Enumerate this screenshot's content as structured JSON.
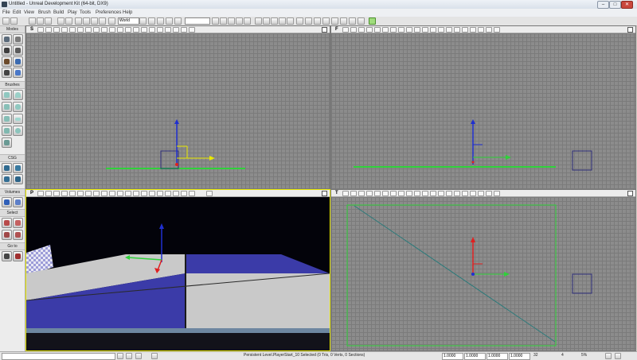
{
  "window": {
    "title": "Untitled - Unreal Development Kit (64-bit, DX9)"
  },
  "menu": [
    "File",
    "Edit",
    "View",
    "Brush",
    "Build",
    "Play",
    "Tools",
    "Preferences",
    "Help"
  ],
  "toolbar": {
    "grid_mode": "World"
  },
  "left_panel": {
    "sections": [
      "Modes",
      "Brushes",
      "CSG",
      "Volumes",
      "Select",
      "Go to"
    ]
  },
  "viewports": [
    {
      "label": "S"
    },
    {
      "label": "F"
    },
    {
      "label": "P"
    },
    {
      "label": "T"
    }
  ],
  "statusbar": {
    "selection": "Persistent Level.PlayerStart_10 Selected (0 Tris, 0 Verts, 0 Sections)",
    "drag_x": "1.0000",
    "drag_y": "1.0000",
    "drag_z": "1.0000",
    "scale": "1.0000",
    "grid": "32",
    "rotation": "4",
    "percent": "5%"
  },
  "colors": {
    "axis_x": "#2fd13a",
    "axis_y": "#e02020",
    "axis_z": "#1f2fd0",
    "viewport_border_active": "#e8e800",
    "floor_blue": "#3b3ba8",
    "floor_grey": "#c9c9c9"
  }
}
